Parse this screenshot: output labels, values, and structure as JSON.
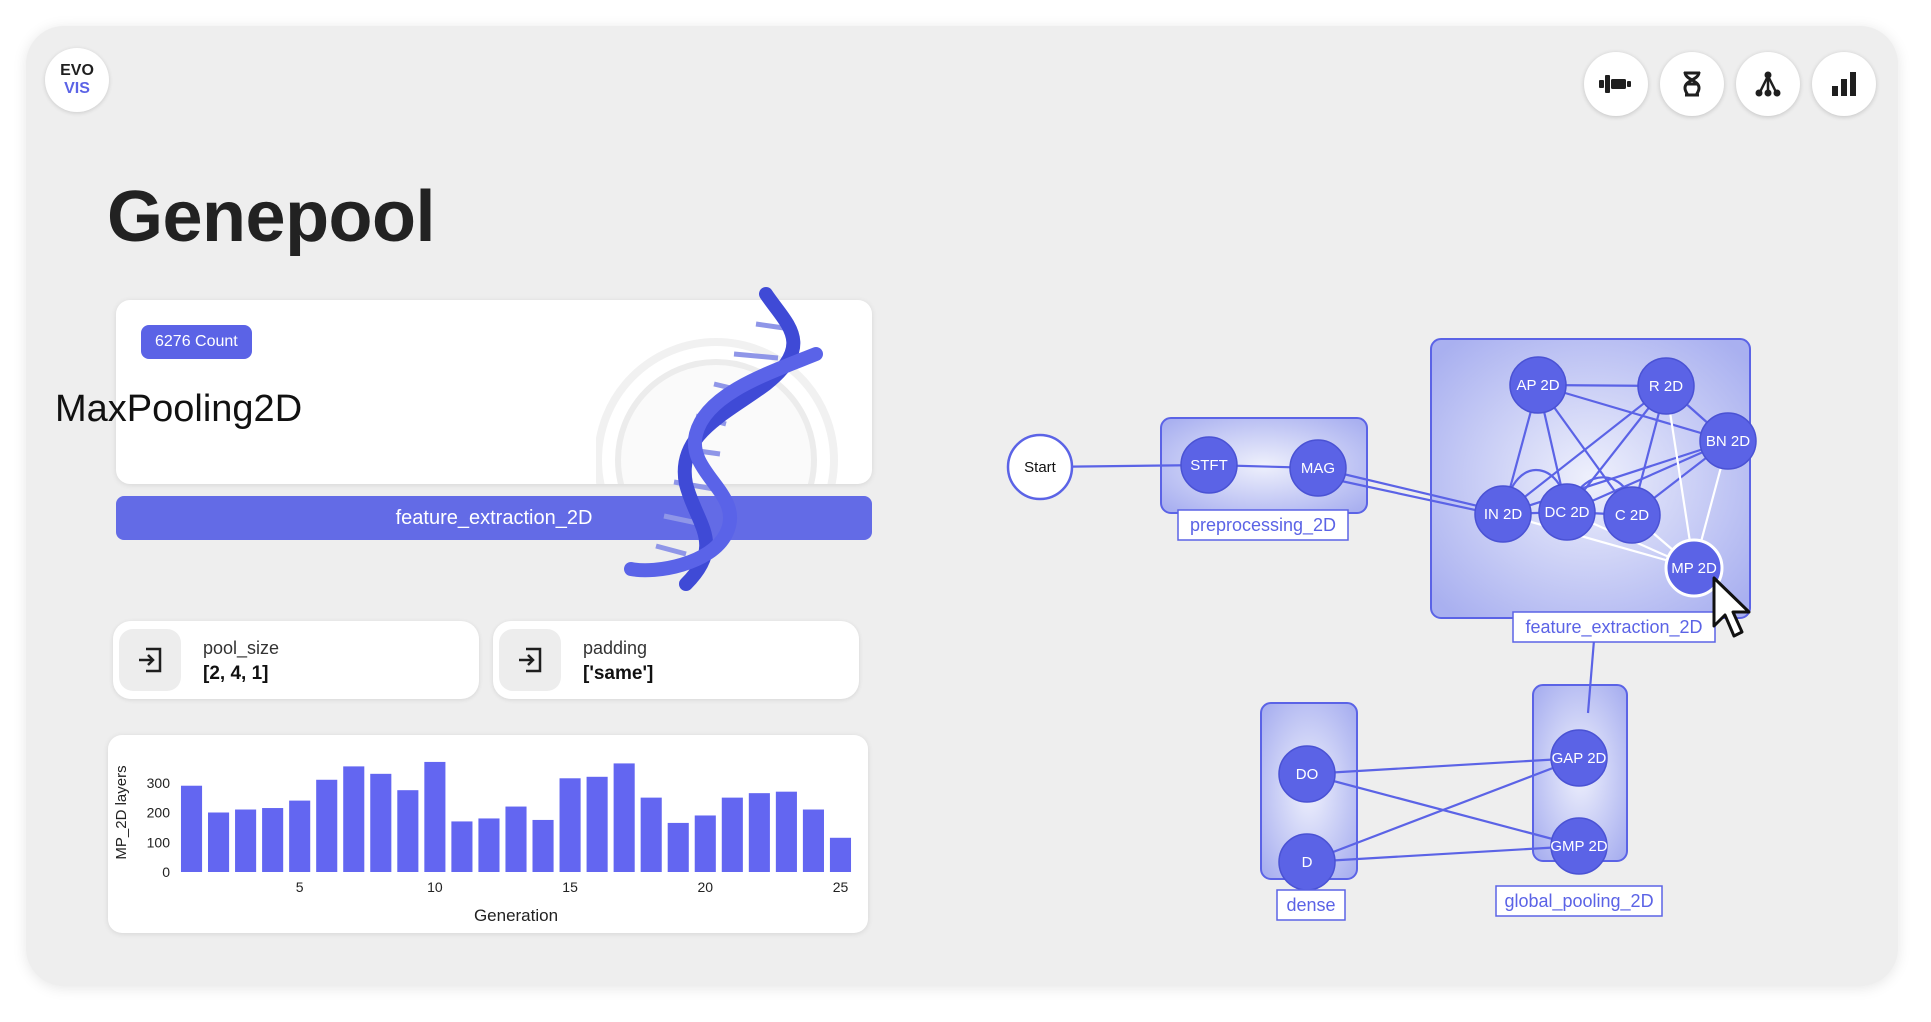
{
  "logo": {
    "line1": "EVO",
    "line2": "VIS"
  },
  "nav": [
    {
      "icon": "architecture-icon"
    },
    {
      "icon": "dna-icon"
    },
    {
      "icon": "tree-icon"
    },
    {
      "icon": "bar-chart-icon"
    }
  ],
  "page": {
    "title": "Genepool"
  },
  "layer": {
    "count_badge": "6276 Count",
    "name": "MaxPooling2D",
    "group": "feature_extraction_2D"
  },
  "params": [
    {
      "name": "pool_size",
      "value": "[2, 4, 1]"
    },
    {
      "name": "padding",
      "value": "['same']"
    }
  ],
  "chart_data": {
    "type": "bar",
    "categories": [
      1,
      2,
      3,
      4,
      5,
      6,
      7,
      8,
      9,
      10,
      11,
      12,
      13,
      14,
      15,
      16,
      17,
      18,
      19,
      20,
      21,
      22,
      23,
      24,
      25
    ],
    "values": [
      290,
      200,
      210,
      215,
      240,
      310,
      355,
      330,
      275,
      370,
      170,
      180,
      220,
      175,
      315,
      320,
      365,
      250,
      165,
      190,
      250,
      265,
      270,
      210,
      115
    ],
    "xlabel": "Generation",
    "ylabel": "MP_2D layers",
    "ylim": [
      0,
      400
    ],
    "yticks": [
      "0",
      "100",
      "200",
      "300"
    ],
    "xticks": [
      "5",
      "10",
      "15",
      "20",
      "25"
    ],
    "color": "#6366f1"
  },
  "graph": {
    "start": "Start",
    "groups": [
      "preprocessing_2D",
      "feature_extraction_2D",
      "dense",
      "global_pooling_2D"
    ],
    "nodes": [
      "STFT",
      "MAG",
      "AP 2D",
      "R 2D",
      "BN 2D",
      "IN 2D",
      "DC 2D",
      "C 2D",
      "MP 2D",
      "DO",
      "D",
      "GAP 2D",
      "GMP 2D"
    ],
    "selected": "MP 2D",
    "accent": "#5b63e6"
  }
}
